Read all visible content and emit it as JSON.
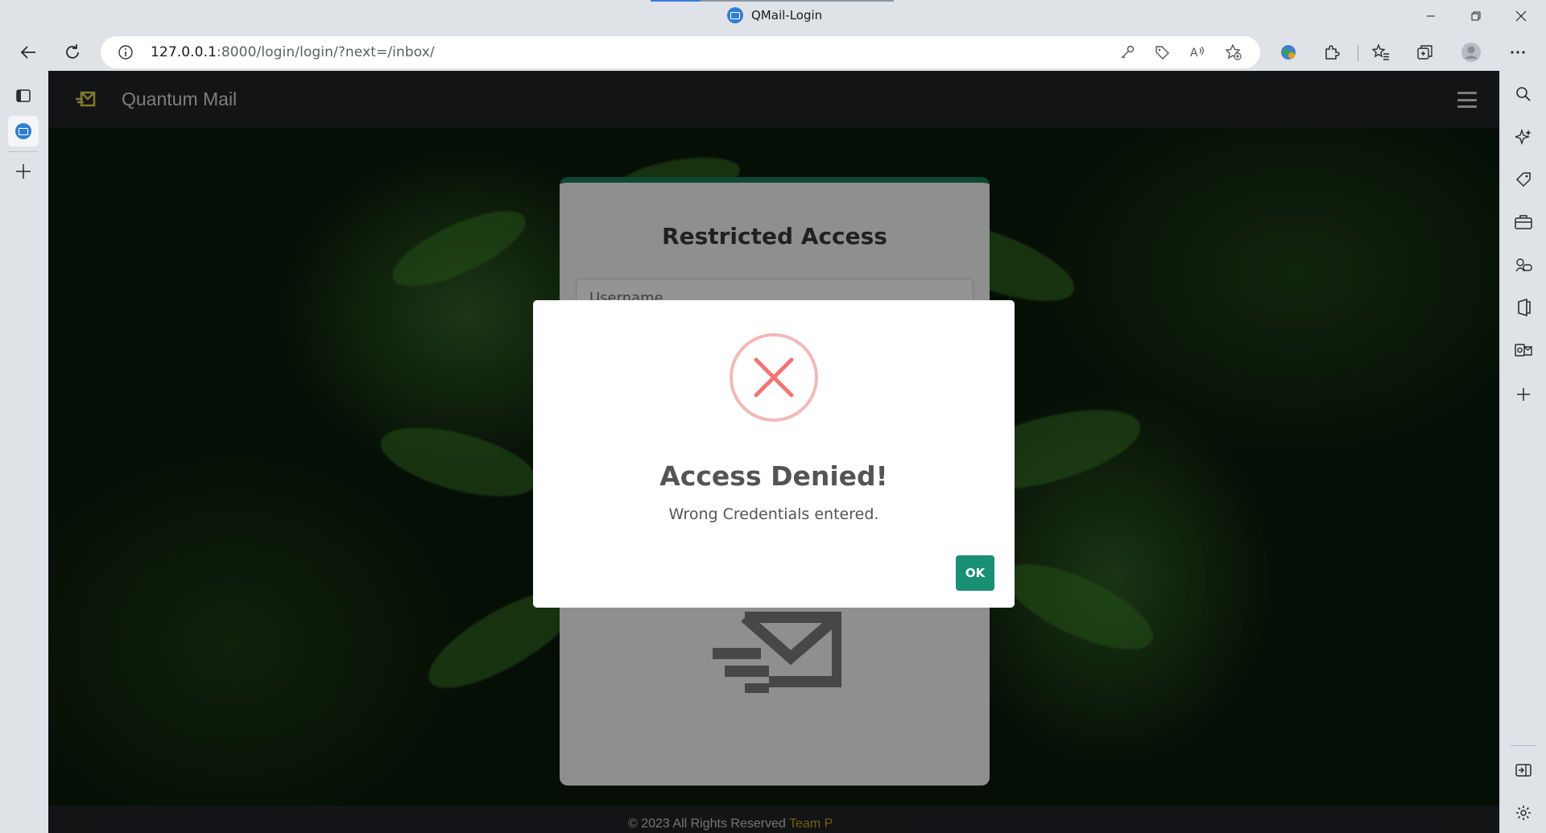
{
  "window": {
    "title": "QMail-Login"
  },
  "address_bar": {
    "host": "127.0.0.1",
    "path": ":8000/login/login/?next=/inbox/"
  },
  "navbar": {
    "brand": "Quantum Mail"
  },
  "login_card": {
    "title": "Restricted Access",
    "username_placeholder": "Username"
  },
  "alert": {
    "title": "Access Denied!",
    "message": "Wrong Credentials entered.",
    "ok_label": "OK",
    "icon": "error-x-icon",
    "accent_color": "#f27474",
    "button_color": "#198f73"
  },
  "footer": {
    "text": "© 2023 All Rights Reserved",
    "link": "Team  P"
  },
  "colors": {
    "card_top_border": "#1a7a5e",
    "navbar": "#1f2327"
  }
}
